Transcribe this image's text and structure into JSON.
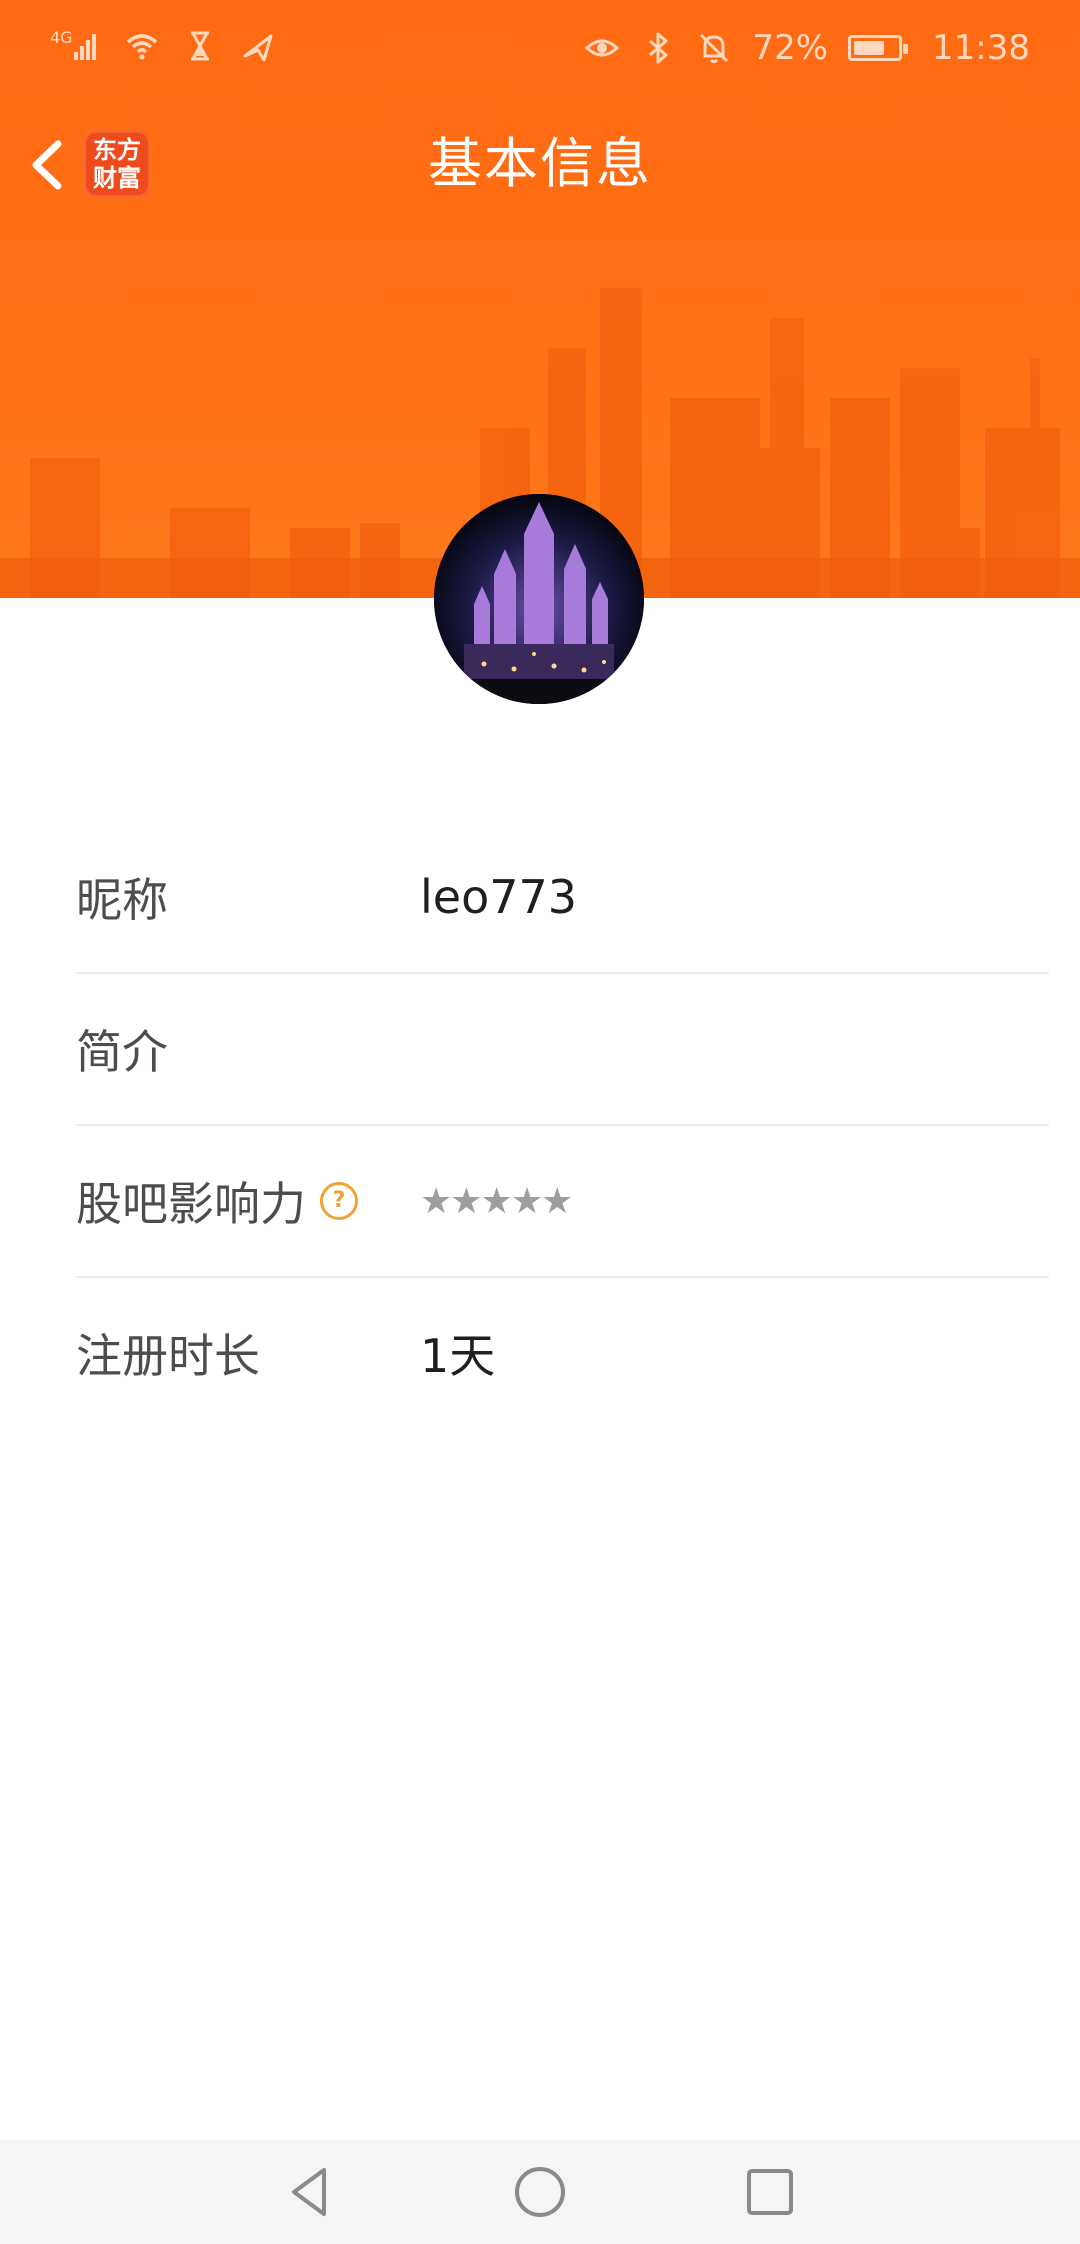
{
  "status_bar": {
    "network_label": "4G",
    "battery_percent": "72%",
    "battery_level": 0.72,
    "time": "11:38",
    "left_icons": [
      "signal-icon",
      "wifi-icon",
      "hourglass-icon",
      "send-icon"
    ],
    "right_icons": [
      "eye-icon",
      "bluetooth-icon",
      "bell-off-icon",
      "battery-icon"
    ]
  },
  "header": {
    "title": "基本信息",
    "logo_line1": "东方",
    "logo_line2": "财富",
    "back_icon": "chevron-left-icon",
    "background_color": "#ff6a12"
  },
  "profile": {
    "rows": [
      {
        "label": "昵称",
        "value": "leo773"
      },
      {
        "label": "简介",
        "value": ""
      },
      {
        "label": "股吧影响力",
        "value": "★★★★★",
        "help_icon": "question-circle-icon"
      },
      {
        "label": "注册时长",
        "value": "1天"
      }
    ]
  },
  "navbar": {
    "buttons": [
      "back-triangle-icon",
      "home-circle-icon",
      "recents-square-icon"
    ]
  },
  "colors": {
    "accent": "#ff6a12",
    "help_icon": "#f0a232",
    "label_text": "#4d4d4d",
    "value_text": "#1f1f1f",
    "divider": "#ececec"
  }
}
